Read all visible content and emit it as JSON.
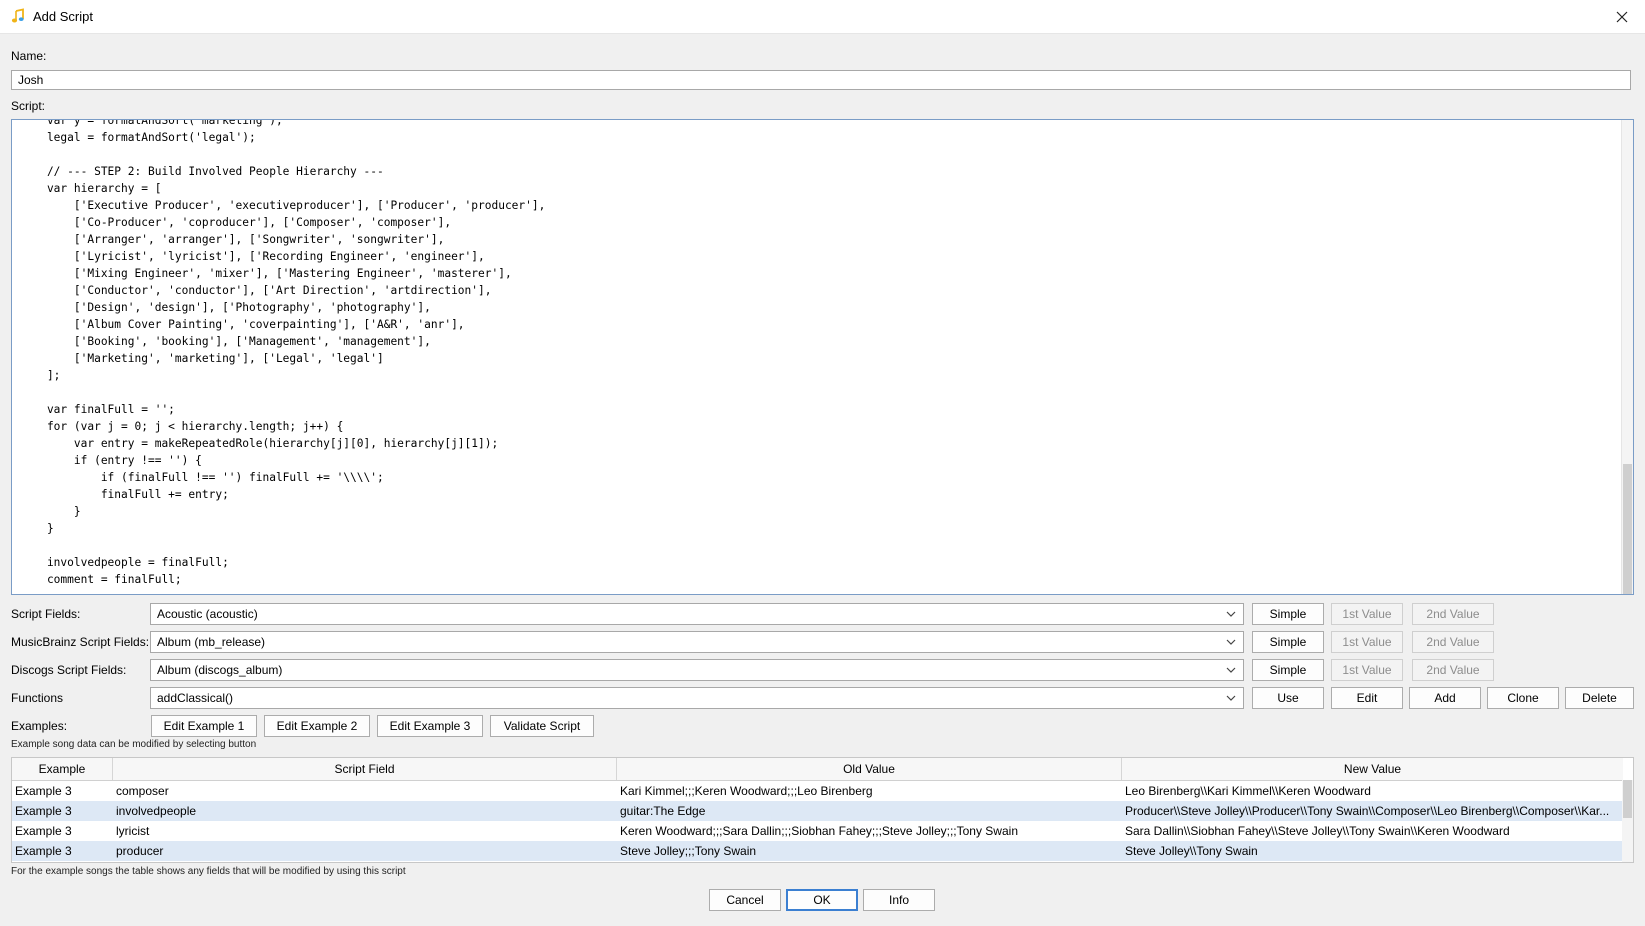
{
  "window": {
    "title": "Add Script"
  },
  "name": {
    "label": "Name:",
    "value": "Josh"
  },
  "script": {
    "label": "Script:",
    "code": "    var y = formatAndSort('marketing');\n    legal = formatAndSort('legal');\n\n    // --- STEP 2: Build Involved People Hierarchy ---\n    var hierarchy = [\n        ['Executive Producer', 'executiveproducer'], ['Producer', 'producer'],\n        ['Co-Producer', 'coproducer'], ['Composer', 'composer'],\n        ['Arranger', 'arranger'], ['Songwriter', 'songwriter'],\n        ['Lyricist', 'lyricist'], ['Recording Engineer', 'engineer'],\n        ['Mixing Engineer', 'mixer'], ['Mastering Engineer', 'masterer'],\n        ['Conductor', 'conductor'], ['Art Direction', 'artdirection'],\n        ['Design', 'design'], ['Photography', 'photography'],\n        ['Album Cover Painting', 'coverpainting'], ['A&R', 'anr'],\n        ['Booking', 'booking'], ['Management', 'management'],\n        ['Marketing', 'marketing'], ['Legal', 'legal']\n    ];\n\n    var finalFull = '';\n    for (var j = 0; j < hierarchy.length; j++) {\n        var entry = makeRepeatedRole(hierarchy[j][0], hierarchy[j][1]);\n        if (entry !== '') {\n            if (finalFull !== '') finalFull += '\\\\\\\\';\n            finalFull += entry;\n        }\n    }\n\n    involvedpeople = finalFull;\n    comment = finalFull;"
  },
  "fields": {
    "script_fields": {
      "label": "Script Fields:",
      "value": "Acoustic (acoustic)"
    },
    "musicbrainz_fields": {
      "label": "MusicBrainz Script Fields:",
      "value": "Album (mb_release)"
    },
    "discogs_fields": {
      "label": "Discogs Script Fields:",
      "value": "Album (discogs_album)"
    },
    "functions": {
      "label": "Functions",
      "value": "addClassical()"
    },
    "simple_label": "Simple",
    "first_value_label": "1st Value",
    "second_value_label": "2nd Value"
  },
  "function_buttons": {
    "use": "Use",
    "edit": "Edit",
    "add": "Add",
    "clone": "Clone",
    "delete": "Delete"
  },
  "examples": {
    "label": "Examples:",
    "edit1": "Edit Example 1",
    "edit2": "Edit Example 2",
    "edit3": "Edit Example 3",
    "validate": "Validate Script",
    "note": "Example song data can be modified by selecting button"
  },
  "table": {
    "headers": [
      "Example",
      "Script Field",
      "Old Value",
      "New Value"
    ],
    "rows": [
      [
        "Example 3",
        "composer",
        "Kari Kimmel;;;Keren Woodward;;;Leo Birenberg",
        "Leo Birenberg\\\\Kari Kimmel\\\\Keren Woodward"
      ],
      [
        "Example 3",
        "involvedpeople",
        "guitar:The Edge",
        "Producer\\\\Steve Jolley\\\\Producer\\\\Tony Swain\\\\Composer\\\\Leo Birenberg\\\\Composer\\\\Kar..."
      ],
      [
        "Example 3",
        "lyricist",
        "Keren Woodward;;;Sara Dallin;;;Siobhan Fahey;;;Steve Jolley;;;Tony Swain",
        "Sara Dallin\\\\Siobhan Fahey\\\\Steve Jolley\\\\Tony Swain\\\\Keren Woodward"
      ],
      [
        "Example 3",
        "producer",
        "Steve Jolley;;;Tony Swain",
        "Steve Jolley\\\\Tony Swain"
      ]
    ],
    "note": "For the example songs the table shows any fields that will be modified by using this script"
  },
  "dialog_buttons": {
    "cancel": "Cancel",
    "ok": "OK",
    "info": "Info"
  },
  "colors": {
    "accent": "#3b7fd1",
    "selection": "#dde8f5",
    "icon": "#f0b418"
  }
}
